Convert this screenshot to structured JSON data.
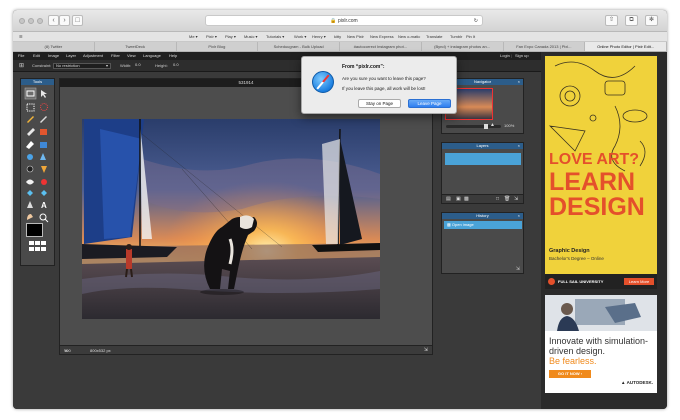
{
  "browser": {
    "url": "pixlr.com",
    "bookmarks": [
      "Me ▾",
      "Pixlr ▾",
      "Play ▾",
      "Music ▾",
      "Tutorials ▾",
      "Work ▾",
      "Henry ▾",
      "kitty",
      "New Pixlr",
      "New Express",
      "New o-matic",
      "Translate",
      "Tumblr",
      "Pin It"
    ],
    "tabs": [
      "(8) Twitter",
      "TweetDeck",
      "Pixlr Blog",
      "Scheduugram - Bulk Upload",
      "#autocorrect Instagram phot...",
      "(Bynd) + instagram photos an...",
      "Fan Expo Canada 2013 | Pixl...",
      "Online Photo Editor | Pixlr Edit..."
    ],
    "active_tab_index": 7
  },
  "app": {
    "menu": [
      "File",
      "Edit",
      "Image",
      "Layer",
      "Adjustment",
      "Filter",
      "View",
      "Language",
      "Help"
    ],
    "login": "Login",
    "signup": "Sign up",
    "options": {
      "constraint_label": "Constraint:",
      "constraint_value": "No restriction",
      "width_label": "Width:",
      "width_value": "0.0",
      "height_label": "Height:",
      "height_value": "0.0"
    },
    "tools_title": "Tools",
    "document": {
      "title": "531914",
      "zoom": "100",
      "zoom_unit": "%",
      "size": "800x532 px"
    },
    "panels": {
      "navigator_title": "Navigator",
      "navigator_zoom": "100",
      "navigator_zoom_unit": "%",
      "layers_title": "Layers",
      "history_title": "History",
      "history_item": "Open image"
    }
  },
  "dialog": {
    "title": "From “pixlr.com”:",
    "message": "Are you sure you want to leave this page?",
    "submessage": "If you leave this page, all work will be lost!",
    "stay_label": "Stay on Page",
    "leave_label": "Leave Page"
  },
  "ads": {
    "ad1": {
      "line1": "LOVE ART?",
      "line2": "LEARN",
      "line3": "DESIGN",
      "program": "Graphic Design",
      "degree": "Bachelor's Degree – Online",
      "school": "FULL SAIL UNIVERSITY",
      "cta": "Learn More"
    },
    "ad2": {
      "headline": "Innovate with simulation-driven design.",
      "tagline": "Be fearless.",
      "cta": "GO IT NOW ›",
      "brand": "AUTODESK."
    }
  },
  "colors": {
    "accent": "#2c5d8a",
    "dialog_button": "#2f7ef0",
    "ad_yellow": "#f0d23b",
    "ad_red": "#e4502b"
  }
}
